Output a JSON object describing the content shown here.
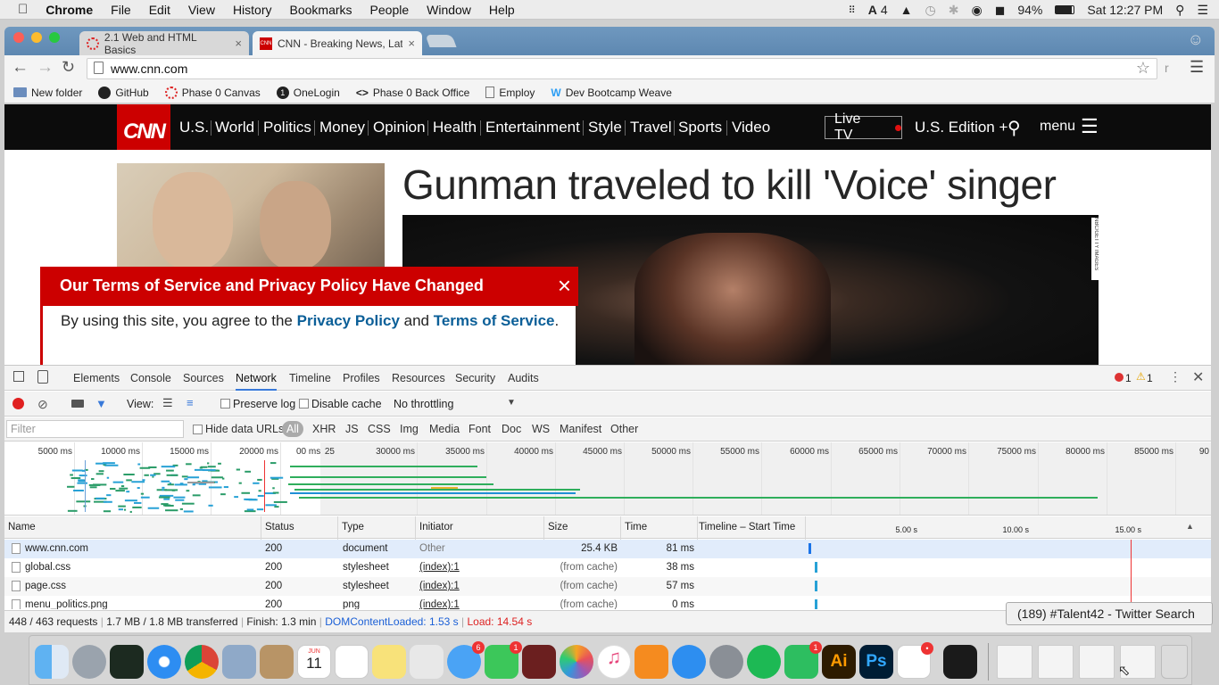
{
  "menubar": {
    "app": "Chrome",
    "items": [
      "File",
      "Edit",
      "View",
      "History",
      "Bookmarks",
      "People",
      "Window",
      "Help"
    ],
    "status_count": "4",
    "battery": "94%",
    "clock": "Sat 12:27 PM"
  },
  "tabs": [
    {
      "title": "2.1 Web and HTML Basics",
      "close": "×"
    },
    {
      "title": "CNN - Breaking News, Late",
      "close": "×"
    }
  ],
  "toolbar": {
    "url": "www.cnn.com",
    "ext_label": "r"
  },
  "bookmarks": [
    "New folder",
    "GitHub",
    "Phase 0 Canvas",
    "OneLogin",
    "Phase 0 Back Office",
    "Employ",
    "Dev Bootcamp Weave"
  ],
  "cnn": {
    "logo": "CNN",
    "nav": [
      "U.S.",
      "World",
      "Politics",
      "Money",
      "Opinion",
      "Health",
      "Entertainment",
      "Style",
      "Travel",
      "Sports",
      "Video"
    ],
    "live_tv": "Live TV",
    "edition": "U.S. Edition +",
    "menu": "menu",
    "headline": "Gunman traveled to kill 'Voice' singer",
    "photo_credit": "NBC/GETTY IMAGES",
    "tos": {
      "title": "Our Terms of Service and Privacy Policy Have Changed",
      "close": "×",
      "text_1": "By using this site, you agree to the ",
      "link_1": "Privacy Policy",
      "text_2": " and ",
      "link_2": "Terms of Service",
      "text_3": "."
    }
  },
  "devtools": {
    "tabs": [
      "Elements",
      "Console",
      "Sources",
      "Network",
      "Timeline",
      "Profiles",
      "Resources",
      "Security",
      "Audits"
    ],
    "active_tab": "Network",
    "errors": "1",
    "warnings": "1",
    "view_label": "View:",
    "preserve_log": "Preserve log",
    "disable_cache": "Disable cache",
    "throttling": "No throttling",
    "filter_placeholder": "Filter",
    "hide_data_urls": "Hide data URLs",
    "filter_types": [
      "All",
      "XHR",
      "JS",
      "CSS",
      "Img",
      "Media",
      "Font",
      "Doc",
      "WS",
      "Manifest",
      "Other"
    ],
    "overview_ticks": [
      "5000 ms",
      "10000 ms",
      "15000 ms",
      "20000 ms",
      "25",
      "00 ms",
      "30000 ms",
      "35000 ms",
      "40000 ms",
      "45000 ms",
      "50000 ms",
      "55000 ms",
      "60000 ms",
      "65000 ms",
      "70000 ms",
      "75000 ms",
      "80000 ms",
      "85000 ms",
      "90"
    ],
    "columns": [
      "Name",
      "Status",
      "Type",
      "Initiator",
      "Size",
      "Time",
      "Timeline – Start Time"
    ],
    "timeline_ticks": [
      "5.00 s",
      "10.00 s",
      "15.00 s"
    ],
    "rows": [
      {
        "name": "www.cnn.com",
        "status": "200",
        "type": "document",
        "initiator": "Other",
        "size": "25.4 KB",
        "time": "81 ms"
      },
      {
        "name": "global.css",
        "status": "200",
        "type": "stylesheet",
        "initiator": "(index):1",
        "size": "(from cache)",
        "time": "38 ms"
      },
      {
        "name": "page.css",
        "status": "200",
        "type": "stylesheet",
        "initiator": "(index):1",
        "size": "(from cache)",
        "time": "57 ms"
      },
      {
        "name": "menu_politics.png",
        "status": "200",
        "type": "png",
        "initiator": "(index):1",
        "size": "(from cache)",
        "time": "0 ms"
      }
    ],
    "status": {
      "requests": "448 / 463 requests",
      "transferred": "1.7 MB / 1.8 MB transferred",
      "finish": "Finish: 1.3 min",
      "dcl": "DOMContentLoaded: 1.53 s",
      "load": "Load: 14.54 s"
    }
  },
  "tooltip": "(189) #Talent42 - Twitter Search",
  "dock": {
    "badges": {
      "messages": "6",
      "facetime": "1",
      "evernote": "1",
      "slack": "•"
    },
    "calendar_month": "JUN",
    "calendar_day": "11",
    "ai_label": "Ai",
    "ps_label": "Ps"
  },
  "colors": {
    "cnn_red": "#cc0000",
    "devtools_blue": "#3879d9",
    "link_blue": "#0b5f98"
  }
}
